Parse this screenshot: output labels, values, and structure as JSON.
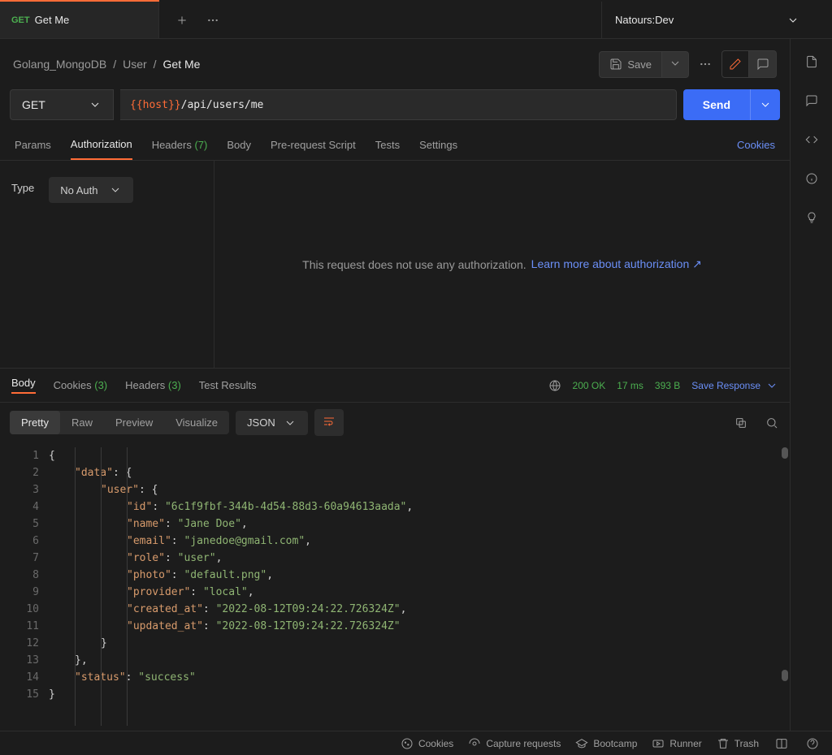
{
  "tab": {
    "method": "GET",
    "title": "Get Me"
  },
  "env": {
    "name": "Natours:Dev"
  },
  "breadcrumb": {
    "a": "Golang_MongoDB",
    "b": "User",
    "c": "Get Me"
  },
  "save_label": "Save",
  "request": {
    "method": "GET",
    "url_var": "{{host}}",
    "url_path": "/api/users/me",
    "send": "Send"
  },
  "req_tabs": {
    "params": "Params",
    "auth": "Authorization",
    "headers": "Headers",
    "headers_count": "(7)",
    "body": "Body",
    "prerequest": "Pre-request Script",
    "tests": "Tests",
    "settings": "Settings",
    "cookies": "Cookies"
  },
  "auth": {
    "type_label": "Type",
    "selected": "No Auth",
    "msg": "This request does not use any authorization.",
    "link": "Learn more about authorization ↗"
  },
  "resp_tabs": {
    "body": "Body",
    "cookies": "Cookies",
    "cookies_count": "(3)",
    "headers": "Headers",
    "headers_count": "(3)",
    "test": "Test Results"
  },
  "resp_meta": {
    "status": "200 OK",
    "time": "17 ms",
    "size": "393 B",
    "save": "Save Response"
  },
  "body_ctrl": {
    "pretty": "Pretty",
    "raw": "Raw",
    "preview": "Preview",
    "visualize": "Visualize",
    "fmt": "JSON"
  },
  "json_body": {
    "data": {
      "user": {
        "id": "6c1f9fbf-344b-4d54-88d3-60a94613aada",
        "name": "Jane Doe",
        "email": "janedoe@gmail.com",
        "role": "user",
        "photo": "default.png",
        "provider": "local",
        "created_at": "2022-08-12T09:24:22.726324Z",
        "updated_at": "2022-08-12T09:24:22.726324Z"
      }
    },
    "status": "success"
  },
  "footer": {
    "cookies": "Cookies",
    "capture": "Capture requests",
    "bootcamp": "Bootcamp",
    "runner": "Runner",
    "trash": "Trash"
  }
}
